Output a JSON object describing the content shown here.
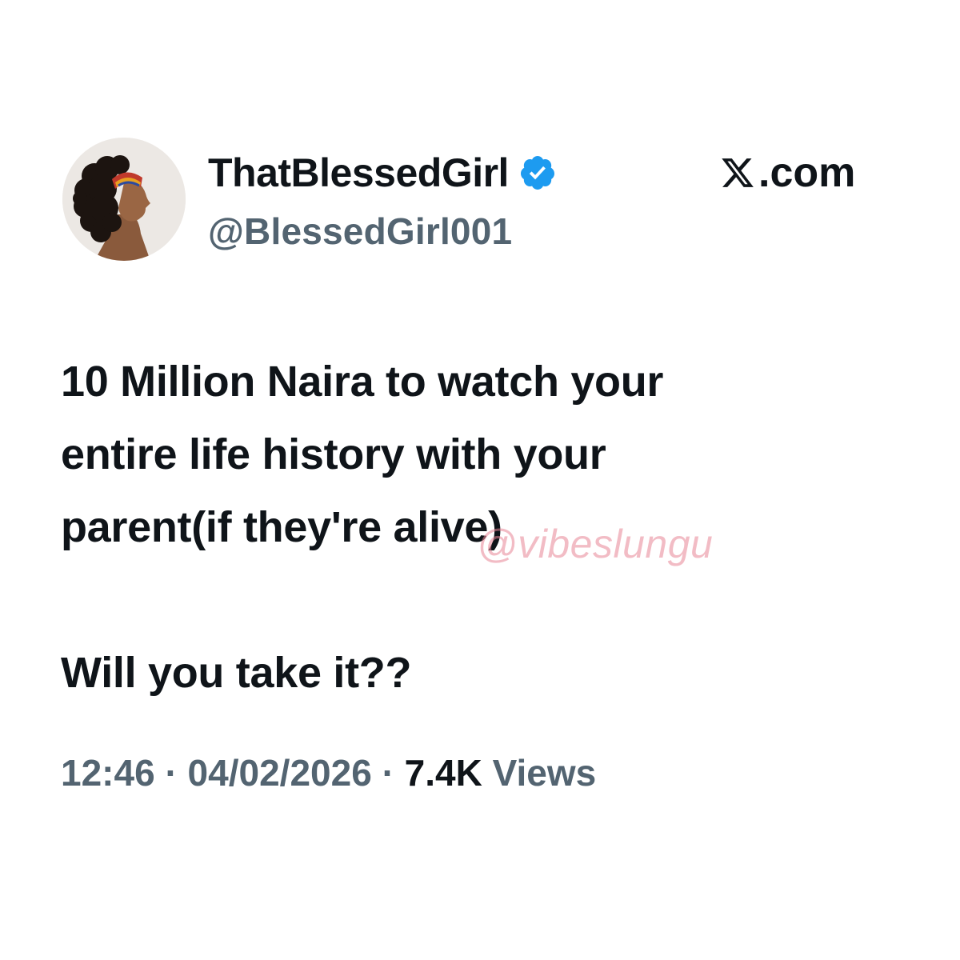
{
  "author": {
    "display_name": "ThatBlessedGirl",
    "handle": "@BlessedGirl001",
    "verified": true,
    "avatar_icon": "profile-avatar-woman-curly-hair"
  },
  "site": {
    "icon": "x-logo-icon",
    "domain": ".com"
  },
  "tweet": {
    "lines": [
      "10 Million Naira to watch your",
      "entire life history with your",
      "parent(if they're alive)"
    ],
    "question": "Will you take it??"
  },
  "watermark": "@vibeslungu",
  "meta": {
    "time": "12:46",
    "separator": "·",
    "date": "04/02/2026",
    "views_count": "7.4K",
    "views_label": "Views"
  },
  "colors": {
    "text_primary": "#0f1419",
    "text_secondary": "#536471",
    "verified_blue": "#1d9bf0",
    "watermark_pink": "#e78596"
  }
}
